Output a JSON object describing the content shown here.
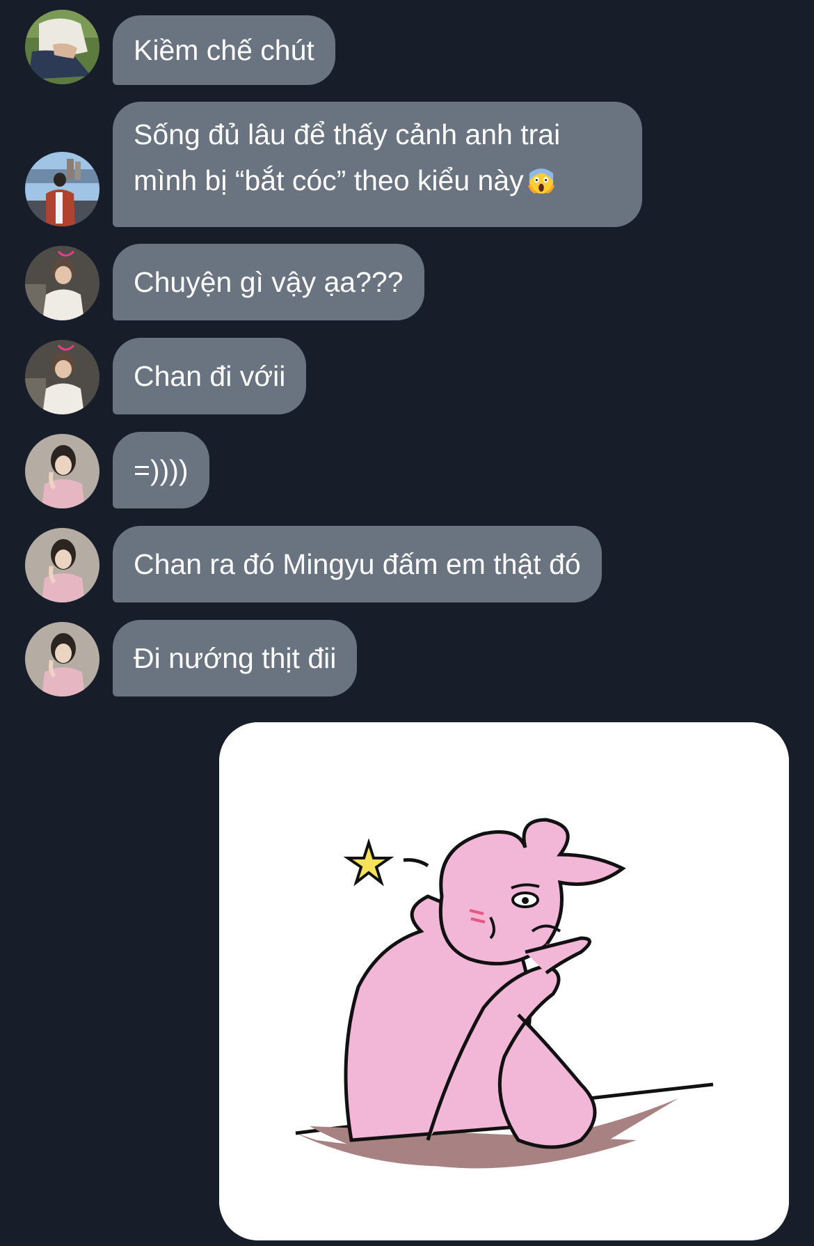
{
  "messages": [
    {
      "text": "Kiềm chế chút",
      "avatar": "avatar-user-a"
    },
    {
      "line1": "Sống đủ lâu để thấy cảnh anh trai",
      "line2": "mình bị “bắt cóc” theo kiểu này",
      "emoji": "face-screaming-in-fear",
      "avatar": "avatar-user-b"
    },
    {
      "text": "Chuyện gì vậy ạa???",
      "avatar": "avatar-user-c"
    },
    {
      "text": "Chan đi vớii",
      "avatar": "avatar-user-c"
    },
    {
      "text": "=))))",
      "avatar": "avatar-user-d"
    },
    {
      "text": "Chan ra đó Mingyu đấm em thật đó",
      "avatar": "avatar-user-d"
    },
    {
      "text": "Đi nướng thịt đii",
      "avatar": "avatar-user-d"
    }
  ],
  "sticker": {
    "subject": "pink-bunny-leaning-on-table"
  },
  "colors": {
    "background": "#171e29",
    "bubble": "#6a7380",
    "text": "#ffffff",
    "sticker_body": "#f2b6d6",
    "table": "#a88282"
  }
}
